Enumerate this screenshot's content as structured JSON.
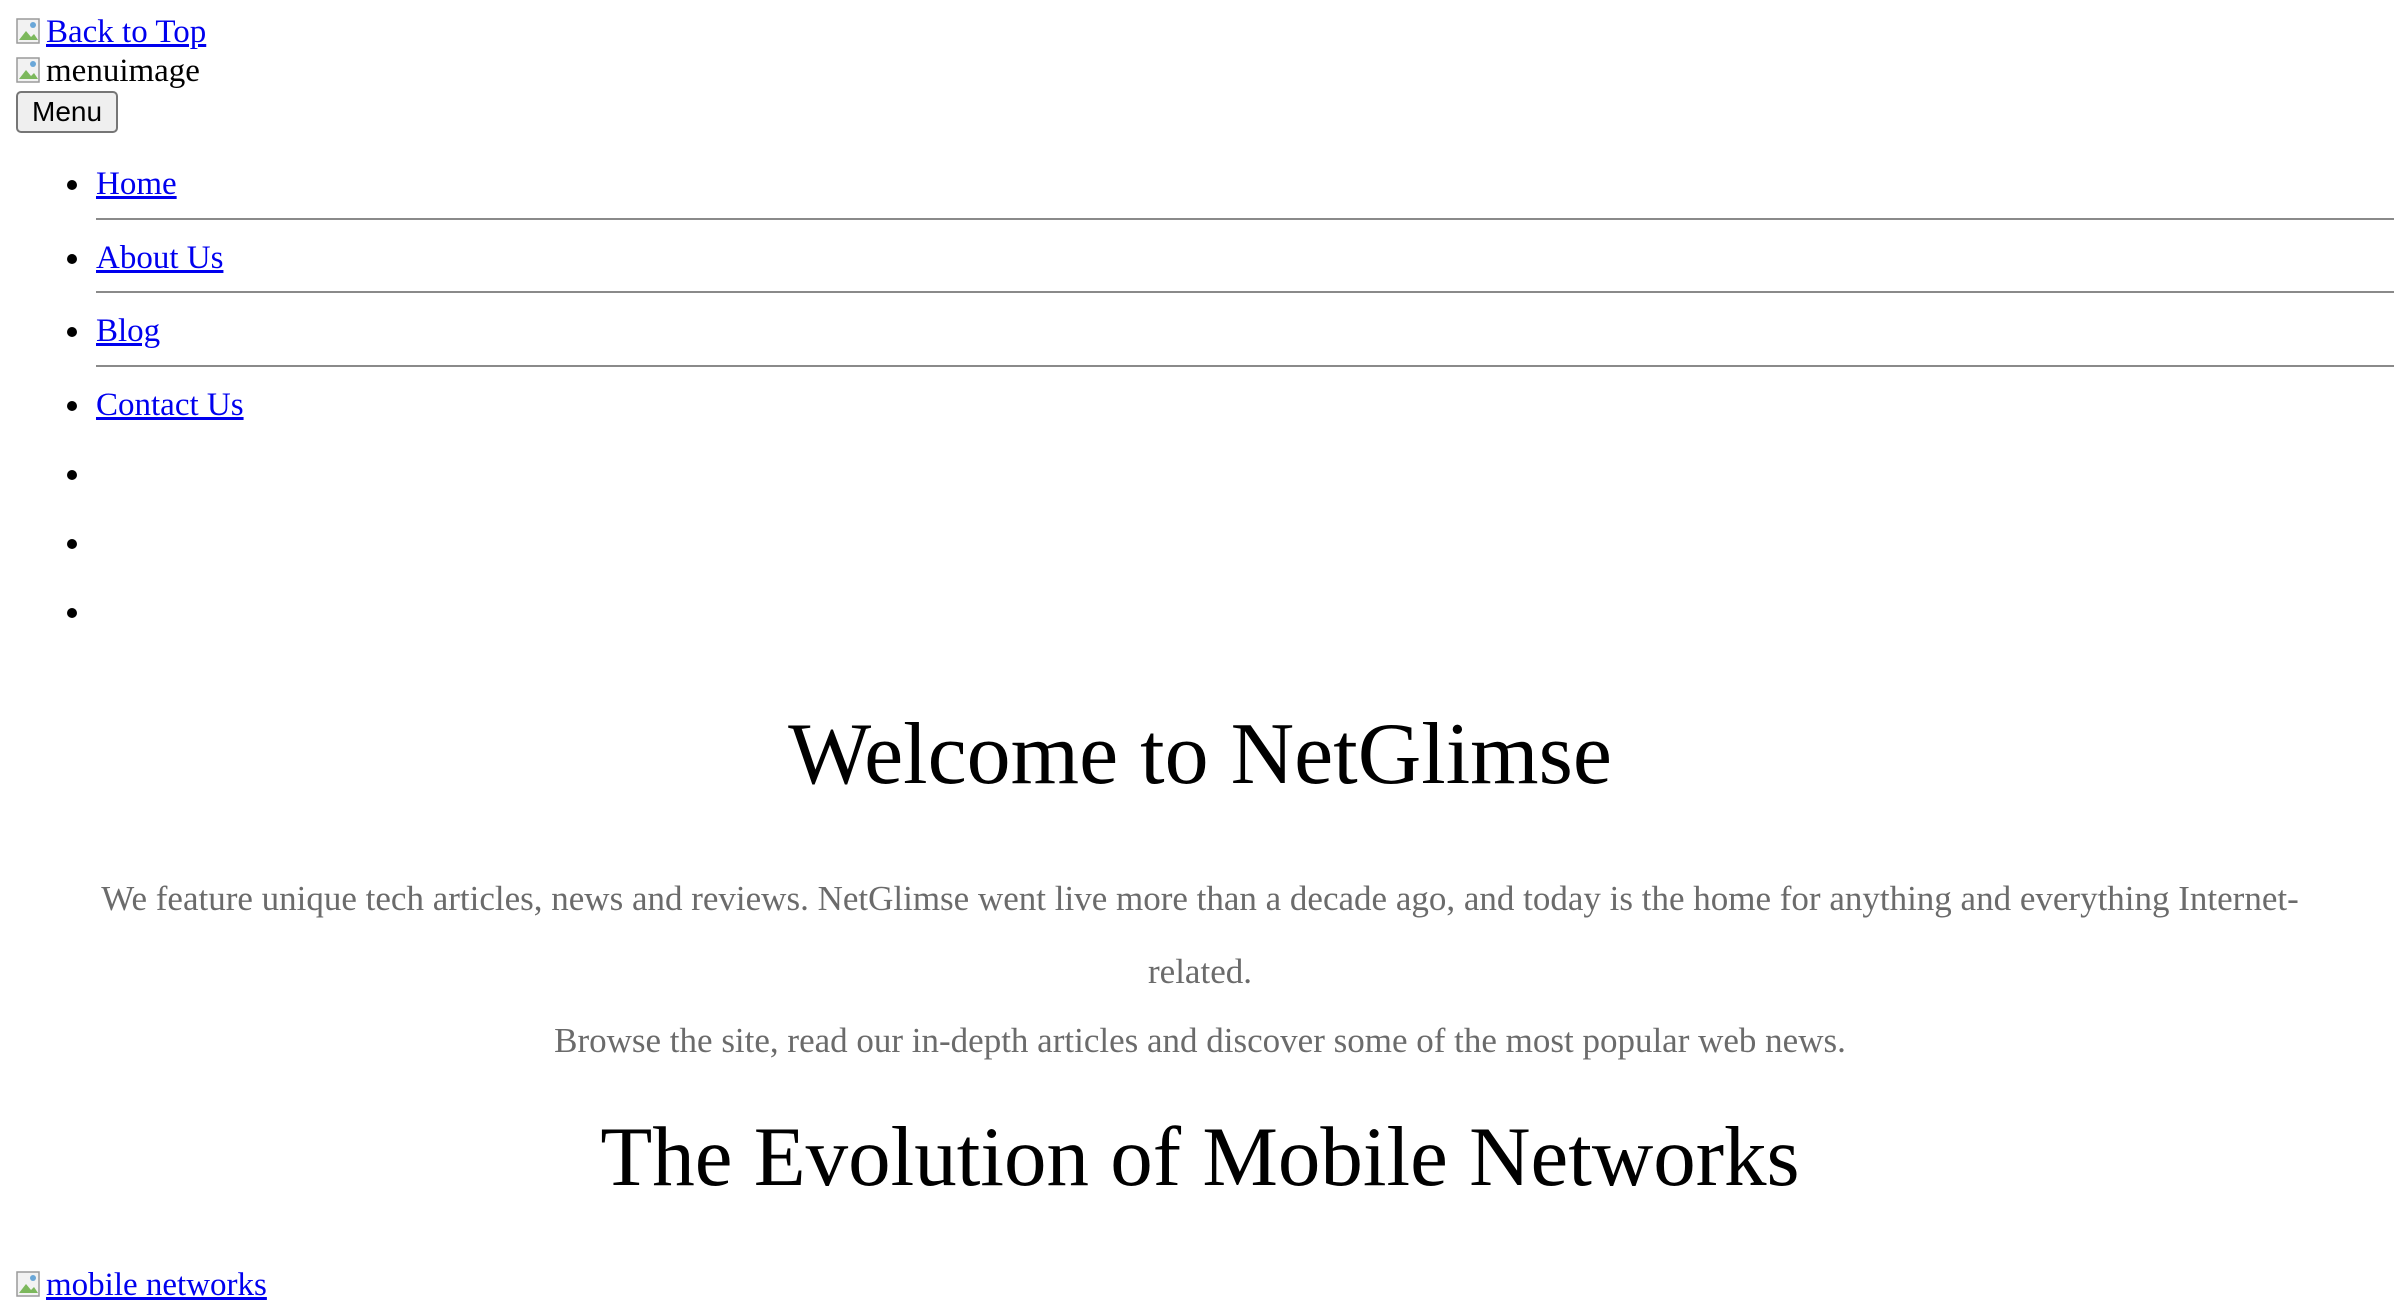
{
  "back_to_top": {
    "alt": "Back to Top",
    "icon": "broken-image-icon"
  },
  "menu_image": {
    "alt": "menuimage",
    "icon": "broken-image-icon"
  },
  "menu_button": {
    "label": "Menu"
  },
  "nav": {
    "items": [
      {
        "label": "Home"
      },
      {
        "label": "About Us"
      },
      {
        "label": "Blog"
      },
      {
        "label": "Contact Us"
      },
      {
        "label": ""
      },
      {
        "label": ""
      },
      {
        "label": ""
      }
    ]
  },
  "hero": {
    "title": "Welcome to NetGlimse",
    "paragraph_1": "We feature unique tech articles, news and reviews. NetGlimse went live more than a decade ago, and today is the home for anything and everything Internet-related.",
    "paragraph_2": "Browse the site, read our in-depth articles and discover some of the most popular web news."
  },
  "article": {
    "title": "The Evolution of Mobile Networks",
    "image_alt": "mobile networks"
  },
  "colors": {
    "link": "#0000ee",
    "muted_text": "#6b6b6b",
    "separator": "#8a8a8a"
  }
}
